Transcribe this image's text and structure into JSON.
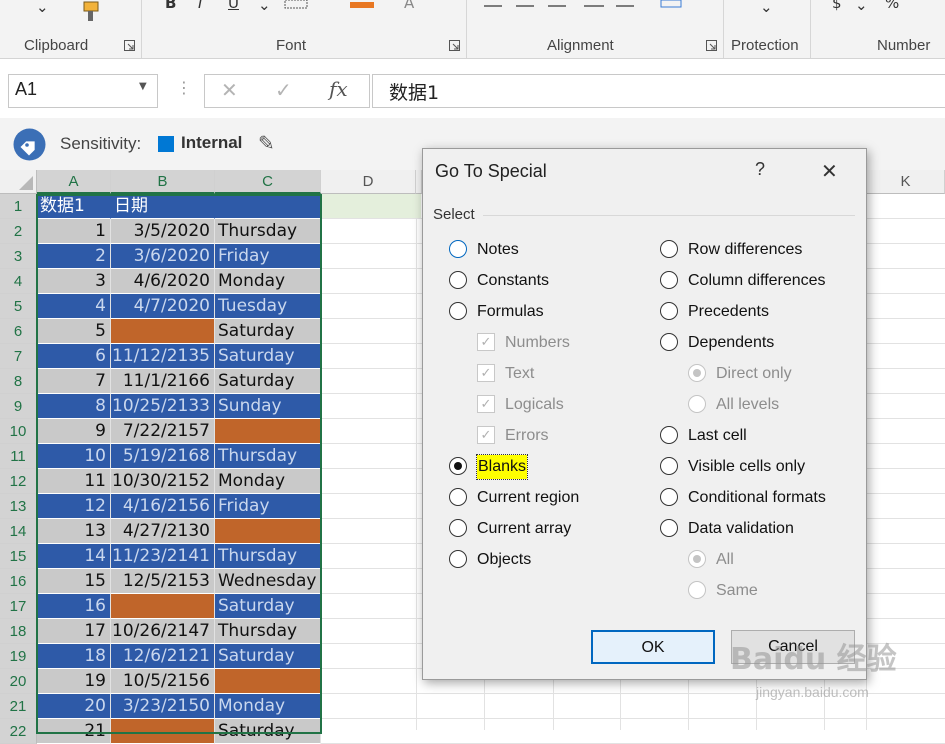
{
  "ribbon": {
    "groups": [
      {
        "label": "Clipboard"
      },
      {
        "label": "Font"
      },
      {
        "label": "Alignment"
      },
      {
        "label": "Protection"
      },
      {
        "label": "Number"
      }
    ]
  },
  "formula_bar": {
    "name_box": "A1",
    "formula": "数据1"
  },
  "sensitivity": {
    "label": "Sensitivity:",
    "value": "Internal",
    "accent": "#0078d4"
  },
  "sheet": {
    "columns": [
      "A",
      "B",
      "C",
      "D",
      "K"
    ],
    "rows": [
      {
        "n": "1",
        "a": "数据1",
        "b": "日期",
        "c": ""
      },
      {
        "n": "2",
        "a": "1",
        "b": "3/5/2020",
        "c": "Thursday"
      },
      {
        "n": "3",
        "a": "2",
        "b": "3/6/2020",
        "c": "Friday"
      },
      {
        "n": "4",
        "a": "3",
        "b": "4/6/2020",
        "c": "Monday"
      },
      {
        "n": "5",
        "a": "4",
        "b": "4/7/2020",
        "c": "Tuesday"
      },
      {
        "n": "6",
        "a": "5",
        "b": "",
        "c": "Saturday"
      },
      {
        "n": "7",
        "a": "6",
        "b": "11/12/2135",
        "c": "Saturday"
      },
      {
        "n": "8",
        "a": "7",
        "b": "11/1/2166",
        "c": "Saturday"
      },
      {
        "n": "9",
        "a": "8",
        "b": "10/25/2133",
        "c": "Sunday"
      },
      {
        "n": "10",
        "a": "9",
        "b": "7/22/2157",
        "c": ""
      },
      {
        "n": "11",
        "a": "10",
        "b": "5/19/2168",
        "c": "Thursday"
      },
      {
        "n": "12",
        "a": "11",
        "b": "10/30/2152",
        "c": "Monday"
      },
      {
        "n": "13",
        "a": "12",
        "b": "4/16/2156",
        "c": "Friday"
      },
      {
        "n": "14",
        "a": "13",
        "b": "4/27/2130",
        "c": ""
      },
      {
        "n": "15",
        "a": "14",
        "b": "11/23/2141",
        "c": "Thursday"
      },
      {
        "n": "16",
        "a": "15",
        "b": "12/5/2153",
        "c": "Wednesday"
      },
      {
        "n": "17",
        "a": "16",
        "b": "",
        "c": "Saturday"
      },
      {
        "n": "18",
        "a": "17",
        "b": "10/26/2147",
        "c": "Thursday"
      },
      {
        "n": "19",
        "a": "18",
        "b": "12/6/2121",
        "c": "Saturday"
      },
      {
        "n": "20",
        "a": "19",
        "b": "10/5/2156",
        "c": ""
      },
      {
        "n": "21",
        "a": "20",
        "b": "3/23/2150",
        "c": "Monday"
      },
      {
        "n": "22",
        "a": "21",
        "b": "",
        "c": "Saturday"
      }
    ],
    "colors": {
      "band_blue": "#2e5aa8",
      "band_gray": "#c9c9c9",
      "blank_orange": "#c0652a",
      "header_blue": "#2e5aa8"
    }
  },
  "dialog": {
    "title": "Go To Special",
    "help": "?",
    "close": "✕",
    "section": "Select",
    "left_options": [
      {
        "label": "Notes",
        "state": "radio"
      },
      {
        "label": "Constants",
        "state": "radio"
      },
      {
        "label": "Formulas",
        "state": "radio"
      },
      {
        "label": "Numbers",
        "state": "check-disabled"
      },
      {
        "label": "Text",
        "state": "check-disabled"
      },
      {
        "label": "Logicals",
        "state": "check-disabled"
      },
      {
        "label": "Errors",
        "state": "check-disabled"
      },
      {
        "label": "Blanks",
        "state": "radio-selected"
      },
      {
        "label": "Current region",
        "state": "radio"
      },
      {
        "label": "Current array",
        "state": "radio"
      },
      {
        "label": "Objects",
        "state": "radio"
      }
    ],
    "right_options": [
      {
        "label": "Row differences",
        "state": "radio"
      },
      {
        "label": "Column differences",
        "state": "radio"
      },
      {
        "label": "Precedents",
        "state": "radio"
      },
      {
        "label": "Dependents",
        "state": "radio"
      },
      {
        "label": "Direct only",
        "state": "radio-disabled-selected"
      },
      {
        "label": "All levels",
        "state": "radio-disabled"
      },
      {
        "label": "Last cell",
        "state": "radio"
      },
      {
        "label": "Visible cells only",
        "state": "radio"
      },
      {
        "label": "Conditional formats",
        "state": "radio"
      },
      {
        "label": "Data validation",
        "state": "radio"
      },
      {
        "label": "All",
        "state": "radio-disabled-selected"
      },
      {
        "label": "Same",
        "state": "radio-disabled"
      }
    ],
    "ok": "OK",
    "cancel": "Cancel",
    "highlight_color": "#ffff00"
  },
  "watermark": {
    "text": "Baidu 经验",
    "sub": "jingyan.baidu.com"
  }
}
